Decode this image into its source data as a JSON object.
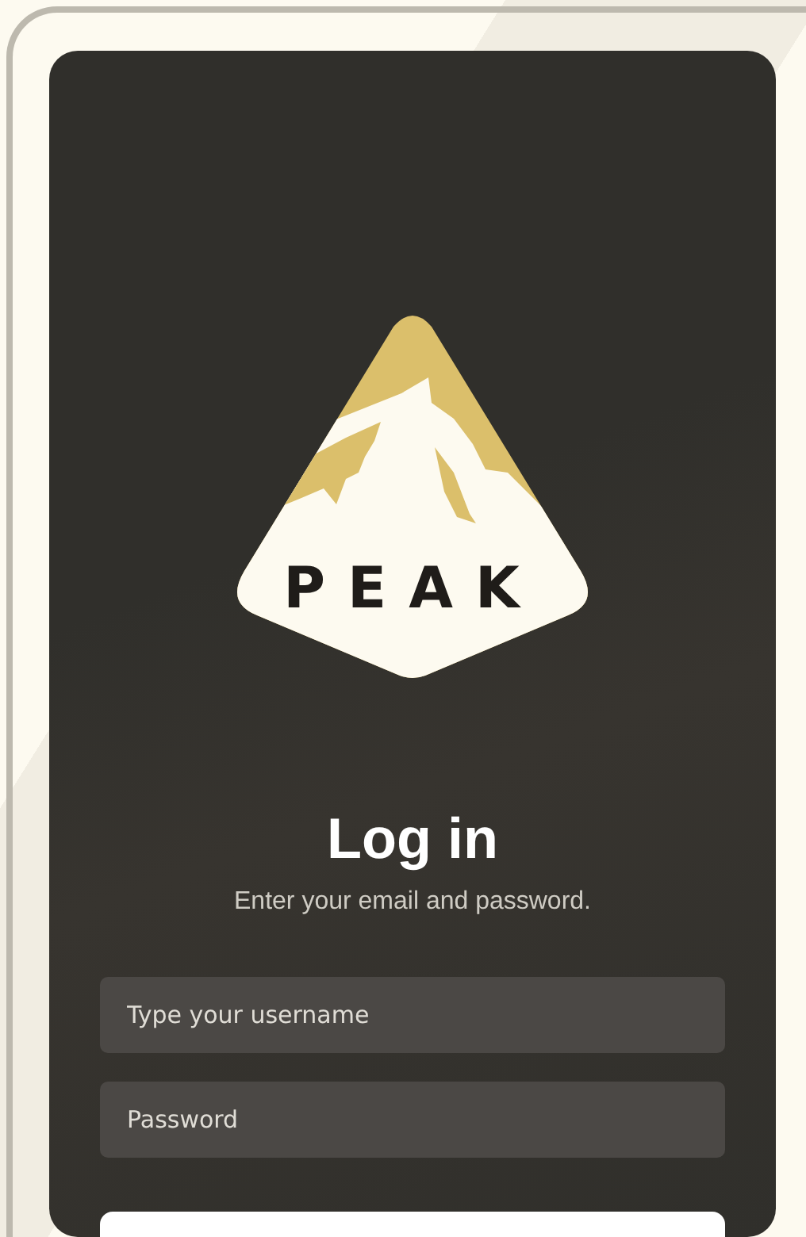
{
  "logo": {
    "text": "PEAK"
  },
  "heading": "Log in",
  "subtitle": "Enter your email and password.",
  "fields": [
    {
      "placeholder": "Type your username"
    },
    {
      "placeholder": "Password"
    }
  ]
}
